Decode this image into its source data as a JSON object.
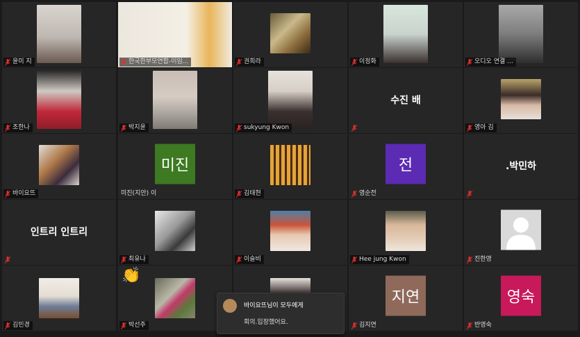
{
  "tiles": [
    {
      "name": "윤미 지"
    },
    {
      "name": "한국한부모연합-이임..."
    },
    {
      "name": "권희라"
    },
    {
      "name": "이정화"
    },
    {
      "name": "오디오 연결 ..."
    },
    {
      "name": "조한나"
    },
    {
      "name": "박지윤"
    },
    {
      "name": "sukyung Kwon"
    },
    {
      "name": "",
      "display": "수진 배"
    },
    {
      "name": "영아 김"
    },
    {
      "name": "바이요뜨"
    },
    {
      "name": "미진(지안) 이",
      "avatar": "미진"
    },
    {
      "name": "김태현"
    },
    {
      "name": "영순전",
      "avatar": "전"
    },
    {
      "name": "",
      "display": ".박민하"
    },
    {
      "name": "",
      "display": "인트리 인트리"
    },
    {
      "name": "최유나"
    },
    {
      "name": "이슬비"
    },
    {
      "name": "Hee jung Kwon"
    },
    {
      "name": "진한영"
    },
    {
      "name": "김민경"
    },
    {
      "name": "박선주"
    },
    {
      "name": ""
    },
    {
      "name": "김지연",
      "avatar": "지연"
    },
    {
      "name": "반영숙",
      "avatar": "영숙"
    }
  ],
  "reaction": "👏",
  "toast": {
    "title": "바이요뜨님이 모두에게",
    "message": "회의.입장했어요."
  },
  "colors": {
    "muted_mic": "#e0302c",
    "avatar_mijin": "#3d7a22",
    "avatar_jeon": "#5b2bb3",
    "avatar_jiyeon": "#8f6a5a",
    "avatar_yeongsuk": "#c8195a"
  }
}
